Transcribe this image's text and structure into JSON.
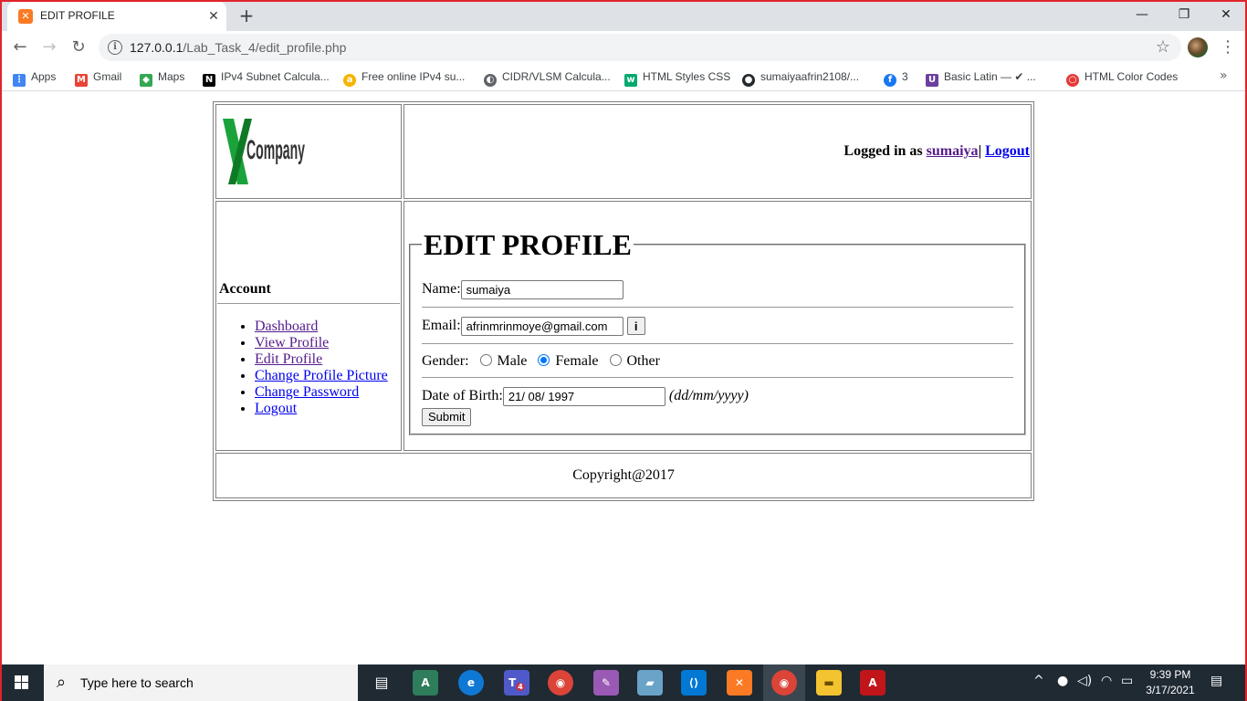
{
  "browser": {
    "tab_title": "EDIT PROFILE",
    "tab_close": "✕",
    "new_tab": "+",
    "window_buttons": {
      "minimize": "—",
      "restore": "❐",
      "close": "✕"
    },
    "url_host": "127.0.0.1",
    "url_path": "/Lab_Task_4/edit_profile.php",
    "bookmarks": [
      {
        "label": "Apps",
        "icon": "apps-grid-icon",
        "color": "#4285f4"
      },
      {
        "label": "Gmail",
        "icon": "gmail-icon",
        "color": "#ea4335"
      },
      {
        "label": "Maps",
        "icon": "maps-icon",
        "color": "#34a853"
      },
      {
        "label": "IPv4 Subnet Calcula...",
        "icon": "notion-icon",
        "color": "#000000"
      },
      {
        "label": "Free online IPv4 su...",
        "icon": "amazon-icon",
        "color": "#f5b400"
      },
      {
        "label": "CIDR/VLSM Calcula...",
        "icon": "globe-icon",
        "color": "#5f6368"
      },
      {
        "label": "HTML Styles CSS",
        "icon": "w3schools-icon",
        "color": "#04aa6d"
      },
      {
        "label": "sumaiyaafrin2108/...",
        "icon": "github-icon",
        "color": "#24292e"
      },
      {
        "label": "3",
        "icon": "facebook-icon",
        "color": "#1877f2"
      },
      {
        "label": "Basic Latin — ✔ ...",
        "icon": "unicode-icon",
        "color": "#6b3fa0"
      },
      {
        "label": "HTML Color Codes",
        "icon": "color-wheel-icon",
        "color": "#e53935"
      }
    ]
  },
  "page": {
    "logo_text": "Company",
    "logo_mark": "X",
    "logged_in_prefix": "Logged in as",
    "username": "sumaiya",
    "separator": "|",
    "logout_label": "Logout",
    "sidebar_title": "Account",
    "sidebar_links": [
      {
        "label": "Dashboard",
        "visited": true
      },
      {
        "label": "View Profile",
        "visited": true
      },
      {
        "label": "Edit Profile",
        "visited": true
      },
      {
        "label": "Change Profile Picture",
        "visited": false
      },
      {
        "label": "Change Password",
        "visited": false
      },
      {
        "label": "Logout",
        "visited": false
      }
    ],
    "form_legend": "EDIT PROFILE",
    "name_label": "Name:",
    "name_value": "sumaiya",
    "email_label": "Email:",
    "email_value": "afrinmrinmoye@gmail.com",
    "email_info_button": "i",
    "gender_label": "Gender:",
    "gender_options": [
      "Male",
      "Female",
      "Other"
    ],
    "gender_selected": "Female",
    "dob_label": "Date of Birth:",
    "dob_value": "21/ 08/ 1997",
    "dob_hint": "(dd/mm/yyyy)",
    "submit_label": "Submit",
    "footer_text": "Copyright@2017"
  },
  "taskbar": {
    "search_placeholder": "Type here to search",
    "teams_badge": "4",
    "time": "9:39 PM",
    "date": "3/17/2021"
  }
}
